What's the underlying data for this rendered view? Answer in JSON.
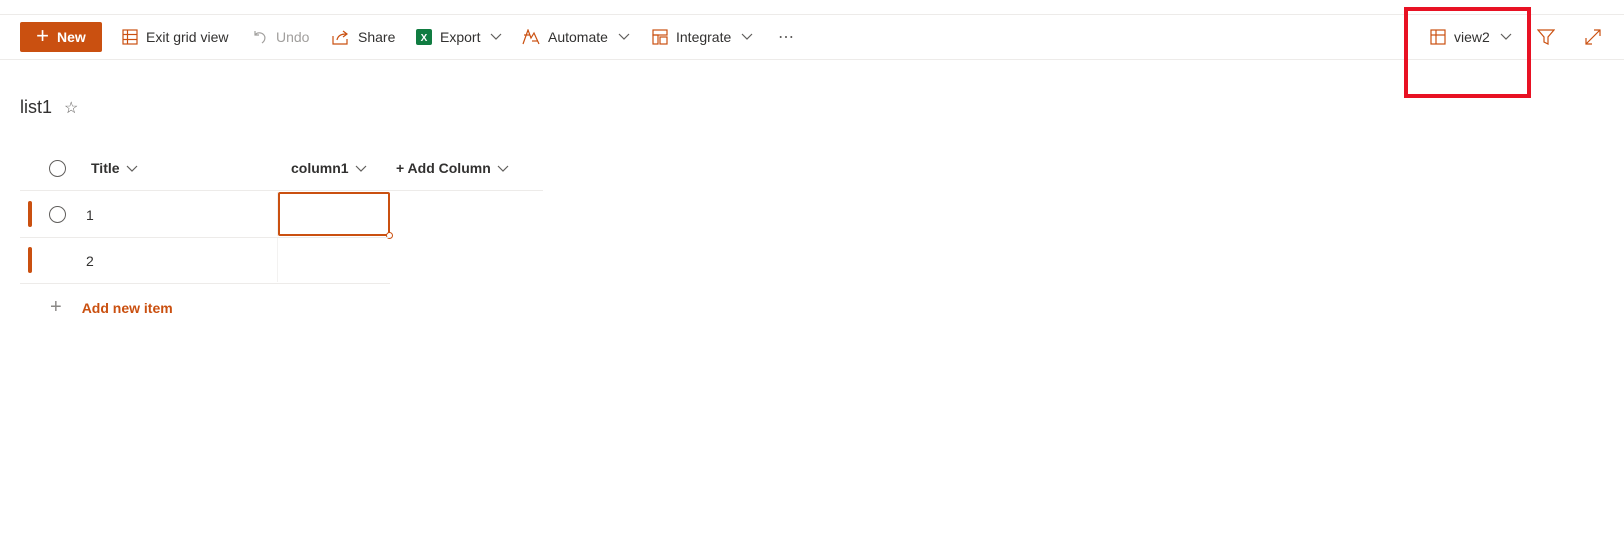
{
  "toolbar": {
    "new_label": "New",
    "exit_grid_label": "Exit grid view",
    "undo_label": "Undo",
    "share_label": "Share",
    "export_label": "Export",
    "automate_label": "Automate",
    "integrate_label": "Integrate",
    "more_label": "⋯",
    "view_label": "view2"
  },
  "list": {
    "title": "list1",
    "star": "☆"
  },
  "grid": {
    "columns": [
      "Title",
      "column1",
      "+ Add Column"
    ],
    "rows": [
      {
        "title": "1",
        "column1": ""
      },
      {
        "title": "2",
        "column1": ""
      }
    ],
    "add_new_item": "Add new item"
  },
  "colors": {
    "accent": "#ca5010",
    "highlight": "#e81123",
    "excel": "#107c41"
  }
}
